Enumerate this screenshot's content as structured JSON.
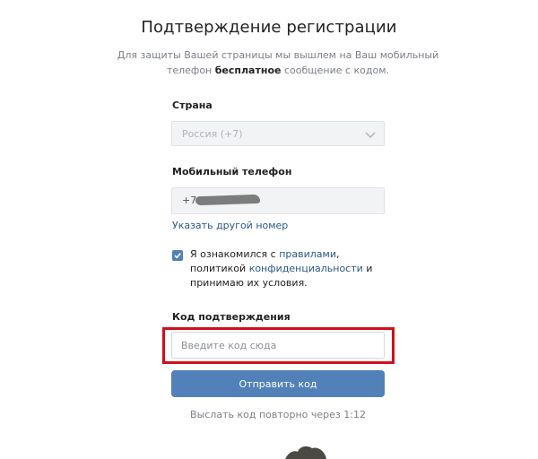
{
  "page": {
    "title": "Подтверждение регистрации",
    "subtitle_part1": "Для защиты Вашей страницы мы вышлем на Ваш мобильный телефон ",
    "subtitle_bold": "бесплатное",
    "subtitle_part2": " сообщение с кодом."
  },
  "country": {
    "label": "Страна",
    "selected": "Россия (+7)",
    "icon": "chevron-down-icon"
  },
  "phone": {
    "label": "Мобильный телефон",
    "prefix": "+7",
    "change_link": "Указать другой номер"
  },
  "agreement": {
    "checked": true,
    "text_part1": "Я ознакомился с ",
    "rules_link": "правилами",
    "text_part2": ", политикой ",
    "privacy_link": "конфиденциальности",
    "text_part3": " и принимаю их условия."
  },
  "code": {
    "label": "Код подтверждения",
    "placeholder": "Введите код сюда",
    "value": ""
  },
  "submit": {
    "label": "Отправить код"
  },
  "resend": {
    "text": "Выслать код повторно через 1:12"
  },
  "colors": {
    "accent": "#5181b8",
    "link": "#2a5885",
    "highlight": "#d0101c"
  }
}
